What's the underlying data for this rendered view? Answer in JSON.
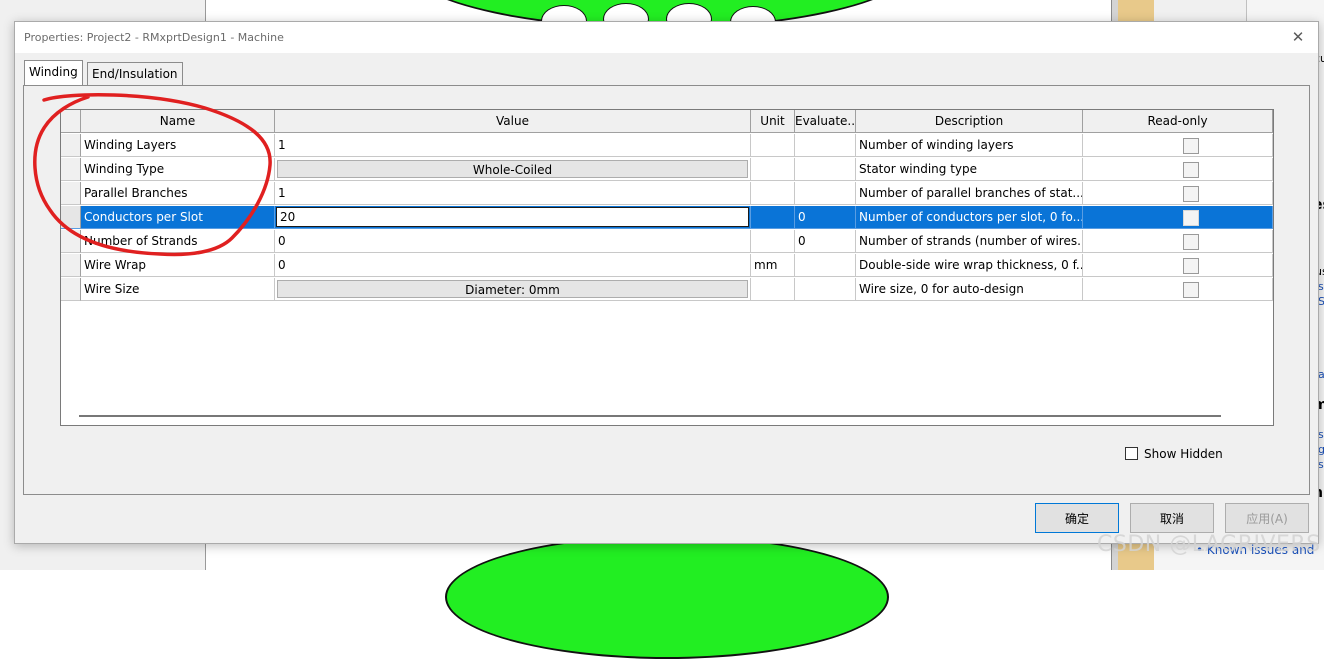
{
  "dialog": {
    "title": "Properties: Project2 - RMxprtDesign1 - Machine",
    "close_glyph": "✕"
  },
  "tabs": [
    {
      "label": "Winding",
      "active": true
    },
    {
      "label": "End/Insulation",
      "active": false
    }
  ],
  "grid": {
    "columns": [
      "Name",
      "Value",
      "Unit",
      "Evaluate...",
      "Description",
      "Read-only"
    ],
    "rows": [
      {
        "name": "Winding Layers",
        "value": "1",
        "unit": "",
        "evaluated": "",
        "description": "Number of winding layers",
        "read_only": false
      },
      {
        "name": "Winding Type",
        "value": "Whole-Coiled",
        "unit": "",
        "evaluated": "",
        "description": "Stator winding type",
        "read_only": false
      },
      {
        "name": "Parallel Branches",
        "value": "1",
        "unit": "",
        "evaluated": "",
        "description": "Number of parallel branches of stat...",
        "read_only": false
      },
      {
        "name": "Conductors per Slot",
        "value": "20",
        "unit": "",
        "evaluated": "0",
        "description": "Number of conductors per slot, 0 fo...",
        "read_only": false
      },
      {
        "name": "Number of Strands",
        "value": "0",
        "unit": "",
        "evaluated": "0",
        "description": "Number of strands (number of wires...",
        "read_only": false
      },
      {
        "name": "Wire Wrap",
        "value": "0",
        "unit": "mm",
        "evaluated": "",
        "description": "Double-side wire wrap thickness, 0 f...",
        "read_only": false
      },
      {
        "name": "Wire Size",
        "value": "Diameter:  0mm",
        "unit": "",
        "evaluated": "",
        "description": "Wire size, 0 for auto-design",
        "read_only": false
      }
    ],
    "selected_row": "Conductors per Slot"
  },
  "show_hidden": {
    "label": "Show Hidden",
    "checked": false
  },
  "buttons": {
    "ok": "确定",
    "cancel": "取消",
    "apply": "应用(A)"
  },
  "background": {
    "fragments": [
      "cu",
      "es",
      "us",
      "s",
      "S",
      "a",
      "m",
      "s",
      "g",
      "s",
      "n"
    ],
    "link_text": "Known issues and",
    "watermark": "CSDN @LAGRIVERS"
  },
  "colors": {
    "selection": "#0a74d7",
    "annotation": "#e02020",
    "motor_fill": "#22ee22"
  },
  "icons": {
    "close": "close-icon",
    "checkbox": "checkbox-icon"
  }
}
